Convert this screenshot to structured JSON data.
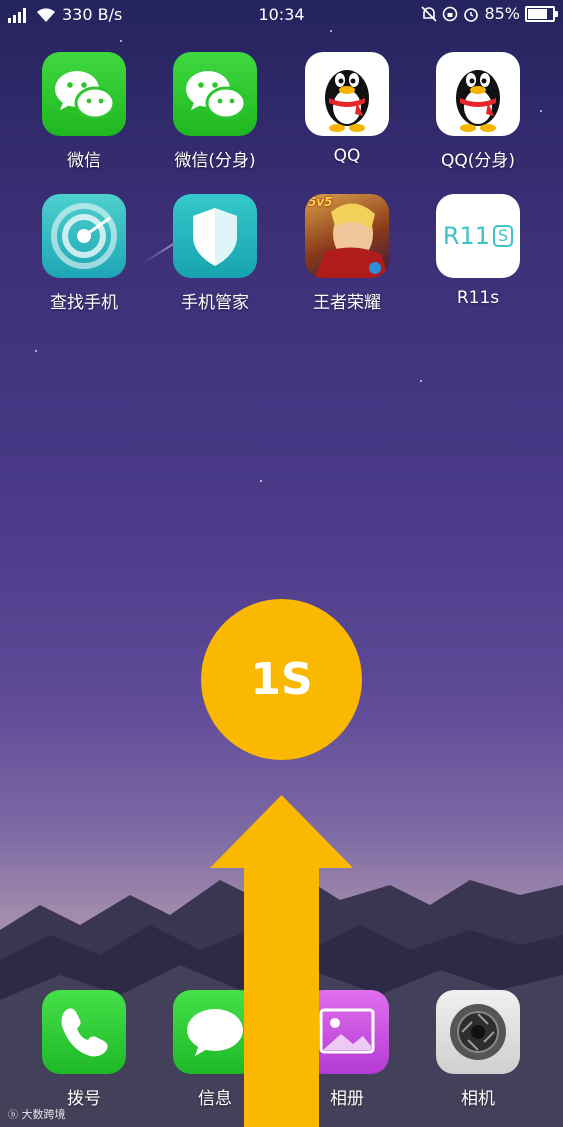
{
  "status_bar": {
    "network_speed": "330 B/s",
    "time": "10:34",
    "battery": "85%",
    "battery_level": 0.85
  },
  "apps_row1": [
    {
      "label": "微信",
      "icon": "wechat-icon"
    },
    {
      "label": "微信(分身)",
      "icon": "wechat-icon"
    },
    {
      "label": "QQ",
      "icon": "qq-penguin-icon"
    },
    {
      "label": "QQ(分身)",
      "icon": "qq-penguin-icon"
    }
  ],
  "apps_row2": [
    {
      "label": "查找手机",
      "icon": "radar-icon"
    },
    {
      "label": "手机管家",
      "icon": "shield-icon"
    },
    {
      "label": "王者荣耀",
      "icon": "game-icon",
      "badge": "5v5"
    },
    {
      "label": "R11s",
      "icon": "r11s-icon",
      "icon_text": "R11",
      "icon_text_boxed": "S"
    }
  ],
  "dock": [
    {
      "label": "拨号",
      "icon": "phone-icon"
    },
    {
      "label": "信息",
      "icon": "message-icon"
    },
    {
      "label": "相册",
      "icon": "gallery-icon"
    },
    {
      "label": "相机",
      "icon": "camera-icon"
    }
  ],
  "overlay": {
    "timer_text": "1S",
    "arrow_color": "#fbb800",
    "watermark": "大数跨境"
  }
}
